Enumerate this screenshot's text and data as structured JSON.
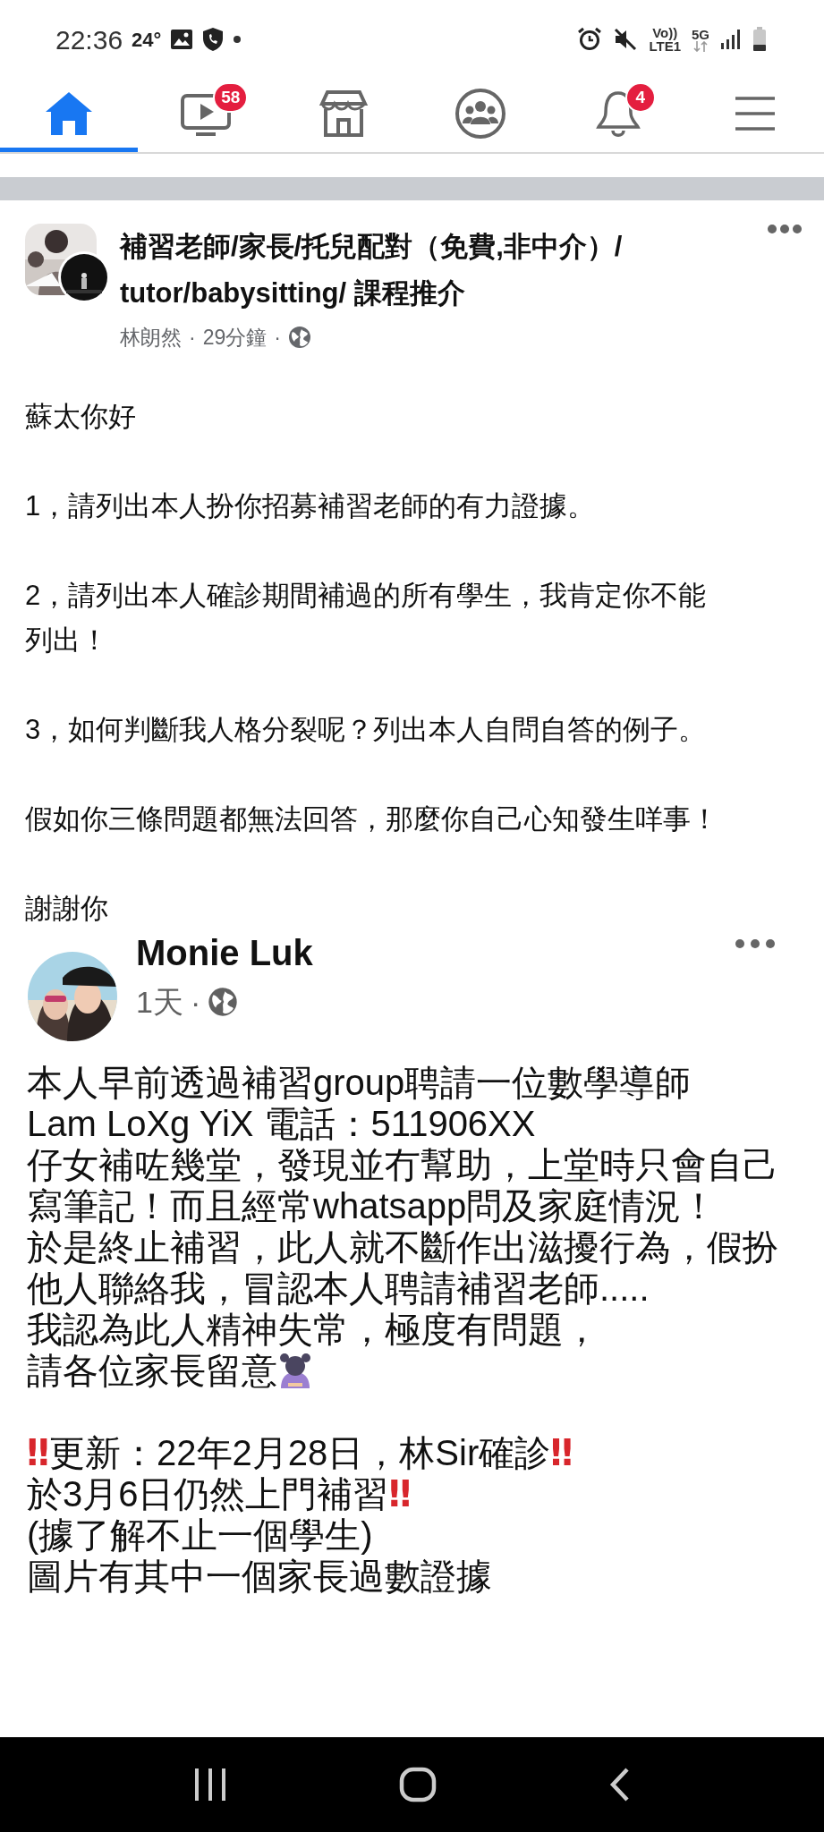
{
  "status_bar": {
    "time": "22:36",
    "temperature": "24°",
    "volte": "Vo))",
    "lte": "LTE1",
    "network": "5G"
  },
  "nav_tabs": [
    {
      "kind": "home",
      "selected": true
    },
    {
      "kind": "video",
      "selected": false,
      "badge": "58"
    },
    {
      "kind": "marketplace",
      "selected": false
    },
    {
      "kind": "groups",
      "selected": false
    },
    {
      "kind": "notifications",
      "selected": false,
      "badge": "4"
    },
    {
      "kind": "menu",
      "selected": false
    }
  ],
  "post": {
    "title_lines": [
      "補習老師/家長/托兒配對（免費,非中介）/",
      "tutor/babysitting/ 課程推介"
    ],
    "author": "林朗然",
    "separator": "·",
    "time": "29分鐘",
    "paragraphs": [
      "蘇太你好",
      "1，請列出本人扮你招募補習老師的有力證據。",
      "2，請列出本人確診期間補過的所有學生，我肯定你不能列出！",
      "3，如何判斷我人格分裂呢？列出本人自問自答的例子。",
      "假如你三條問題都無法回答，那麼你自己心知發生咩事！",
      "謝謝你"
    ]
  },
  "shared_image": {
    "author": "Monie Luk",
    "time": "1天",
    "separator": "·",
    "paragraphs": [
      [
        [
          {
            "kind": "text",
            "text": "本人早前透過補習group聘請一位數學導師"
          }
        ],
        [
          {
            "kind": "text",
            "text": "Lam LoXg YiX 電話：511906XX"
          }
        ],
        [
          {
            "kind": "text",
            "text": "仔女補咗幾堂，發現並冇幫助，上堂時只會自己"
          }
        ],
        [
          {
            "kind": "text",
            "text": "寫筆記！而且經常whatsapp問及家庭情況！"
          }
        ],
        [
          {
            "kind": "text",
            "text": "於是終止補習，此人就不斷作出滋擾行為，假扮"
          }
        ],
        [
          {
            "kind": "text",
            "text": "他人聯絡我，冒認本人聘請補習老師....."
          }
        ],
        [
          {
            "kind": "text",
            "text": "我認為此人精神失常，極度有問題，"
          }
        ],
        [
          {
            "kind": "text",
            "text": "請各位家長留意"
          },
          {
            "kind": "bowing"
          }
        ]
      ],
      [
        [
          {
            "kind": "bangbang",
            "text": "‼"
          },
          {
            "kind": "text",
            "text": "更新：22年2月28日，林Sir確診"
          },
          {
            "kind": "bangbang",
            "text": "‼"
          }
        ],
        [
          {
            "kind": "text",
            "text": "於3月6日仍然上門補習"
          },
          {
            "kind": "bangbang",
            "text": "‼"
          }
        ],
        [
          {
            "kind": "text",
            "text": "(據了解不止一個學生)"
          }
        ],
        [
          {
            "kind": "text",
            "text": "圖片有其中一個家長過數證據"
          }
        ]
      ]
    ]
  }
}
